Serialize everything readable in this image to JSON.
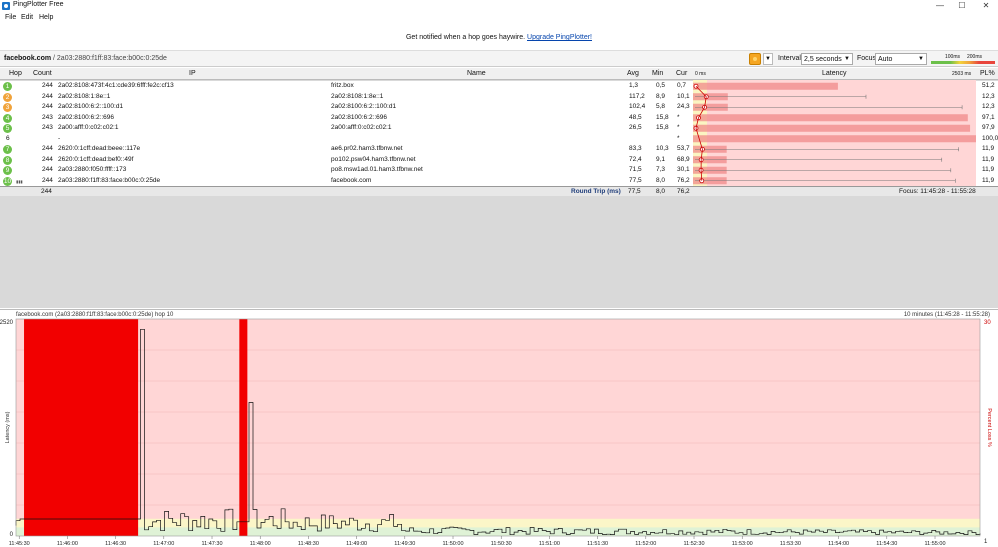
{
  "app": {
    "title": "PingPlotter Free"
  },
  "window_controls": {
    "minimize": "—",
    "maximize": "☐",
    "close": "✕"
  },
  "menu": {
    "file": "File",
    "edit": "Edit",
    "help": "Help"
  },
  "banner": {
    "text": "Get notified when a hop goes haywire.",
    "link": "Upgrade PingPlotter!"
  },
  "toolbar": {
    "target": "facebook.com",
    "target_ip": " / 2a03:2880:f1ff:83:face:b00c:0:25de",
    "interval_label": "Interval",
    "interval_value": "2,5 seconds",
    "focus_label": "Focus",
    "focus_value": "Auto",
    "scale_low": "100ms",
    "scale_high": "200ms"
  },
  "table": {
    "headers": {
      "hop": "Hop",
      "count": "Count",
      "ip": "IP",
      "name": "Name",
      "avg": "Avg",
      "min": "Min",
      "cur": "Cur",
      "latency_min": "0 ms",
      "latency": "Latency",
      "latency_max": "2503 ms",
      "pl": "PL%"
    },
    "rows": [
      {
        "hop": "1",
        "count": "244",
        "ip": "2a02:8108:473f:4c1:cde39:6fff:fe2c:cf13",
        "name": "fritz.box",
        "avg": "1,3",
        "min": "0,5",
        "cur": "0,7",
        "pl": "51,2",
        "color": "#6cc04a",
        "avgv": 1.3,
        "curv": 0.7,
        "maxv": 0,
        "plv": 51.2
      },
      {
        "hop": "2",
        "count": "244",
        "ip": "2a02:8108:1:8e::1",
        "name": "2a02:8108:1:8e::1",
        "avg": "117,2",
        "min": "8,9",
        "cur": "10,1",
        "pl": "12,3",
        "color": "#f0a33b",
        "avgv": 117.2,
        "curv": 10.1,
        "maxv": 1530,
        "plv": 12.3
      },
      {
        "hop": "3",
        "count": "244",
        "ip": "2a02:8100:6:2::100:d1",
        "name": "2a02:8100:6:2::100:d1",
        "avg": "102,4",
        "min": "5,8",
        "cur": "24,3",
        "pl": "12,3",
        "color": "#f0a33b",
        "avgv": 102.4,
        "curv": 24.3,
        "maxv": 2380,
        "plv": 12.3
      },
      {
        "hop": "4",
        "count": "243",
        "ip": "2a02:8100:6:2::696",
        "name": "2a02:8100:6:2::696",
        "avg": "48,5",
        "min": "15,8",
        "cur": "*",
        "pl": "97,1",
        "color": "#6cc04a",
        "avgv": 48.5,
        "curv": null,
        "maxv": 0,
        "plv": 97.1
      },
      {
        "hop": "5",
        "count": "243",
        "ip": "2a00:afff:0:c02:c02:1",
        "name": "2a00:afff:0:c02:c02:1",
        "avg": "26,5",
        "min": "15,8",
        "cur": "*",
        "pl": "97,9",
        "color": "#6cc04a",
        "avgv": 26.5,
        "curv": null,
        "maxv": 0,
        "plv": 97.9
      },
      {
        "hop": "6",
        "count": "",
        "ip": "-",
        "name": "",
        "avg": "",
        "min": "",
        "cur": "*",
        "pl": "100,0",
        "color": "",
        "avgv": null,
        "curv": null,
        "maxv": 0,
        "plv": 100
      },
      {
        "hop": "7",
        "count": "244",
        "ip": "2620:0:1cff:dead:beee::117e",
        "name": "ae6.pr02.ham3.tfbnw.net",
        "avg": "83,3",
        "min": "10,3",
        "cur": "53,7",
        "pl": "11,9",
        "color": "#6cc04a",
        "avgv": 83.3,
        "curv": 53.7,
        "maxv": 2350,
        "plv": 11.9
      },
      {
        "hop": "8",
        "count": "244",
        "ip": "2620:0:1cff:dead:bef0::49f",
        "name": "po102.psw04.ham3.tfbnw.net",
        "avg": "72,4",
        "min": "9,1",
        "cur": "68,9",
        "pl": "11,9",
        "color": "#6cc04a",
        "avgv": 72.4,
        "curv": 68.9,
        "maxv": 2200,
        "plv": 11.9
      },
      {
        "hop": "9",
        "count": "244",
        "ip": "2a03:2880:f050:ffff::173",
        "name": "po8.msw1ad.01.ham3.tfbnw.net",
        "avg": "71,5",
        "min": "7,3",
        "cur": "30,1",
        "pl": "11,9",
        "color": "#6cc04a",
        "avgv": 71.5,
        "curv": 30.1,
        "maxv": 2280,
        "plv": 11.9
      },
      {
        "hop": "10",
        "count": "244",
        "ip": "2a03:2880:f1ff:83:face:b00c:0:25de",
        "name": "facebook.com",
        "avg": "77,5",
        "min": "8,0",
        "cur": "76,2",
        "pl": "11,9",
        "color": "#6cc04a",
        "avgv": 77.5,
        "curv": 76.2,
        "maxv": 2320,
        "plv": 11.9
      }
    ],
    "roundtrip": {
      "count": "244",
      "label": "Round Trip (ms)",
      "avg": "77,5",
      "min": "8,0",
      "cur": "76,2",
      "focus": "Focus: 11:45:28 - 11:55:28"
    }
  },
  "graph": {
    "title": "facebook.com (2a03:2880:f1ff:83:face:b00c:0:25de) hop 10",
    "range": "10 minutes (11:45:28 - 11:55:28)",
    "y_max_label": "2520",
    "y_min_label": "0",
    "y_axis_title": "Latency (ms)",
    "right_max_label": "30",
    "right_min_label": "1",
    "right_axis_title": "Percent Loss %",
    "x_labels": [
      "11:45:30",
      "11:46:00",
      "11:46:30",
      "11:47:00",
      "11:47:30",
      "11:48:00",
      "11:48:30",
      "11:49:00",
      "11:49:30",
      "11:50:00",
      "11:50:30",
      "11:51:00",
      "11:51:30",
      "11:52:00",
      "11:52:30",
      "11:53:00",
      "11:53:30",
      "11:54:00",
      "11:54:30",
      "11:55:00"
    ]
  },
  "chart_data": {
    "type": "line",
    "ylabel": "Latency (ms)",
    "ylim": [
      0,
      2520
    ],
    "loss_spans": [
      {
        "start": "11:45:33",
        "end": "11:46:44",
        "loss_pct": 100
      },
      {
        "start": "11:47:47",
        "end": "11:47:52",
        "loss_pct": 100
      }
    ],
    "spikes": [
      {
        "time": "11:46:45",
        "latency": 2400
      },
      {
        "time": "11:47:53",
        "latency": 1550
      }
    ]
  }
}
